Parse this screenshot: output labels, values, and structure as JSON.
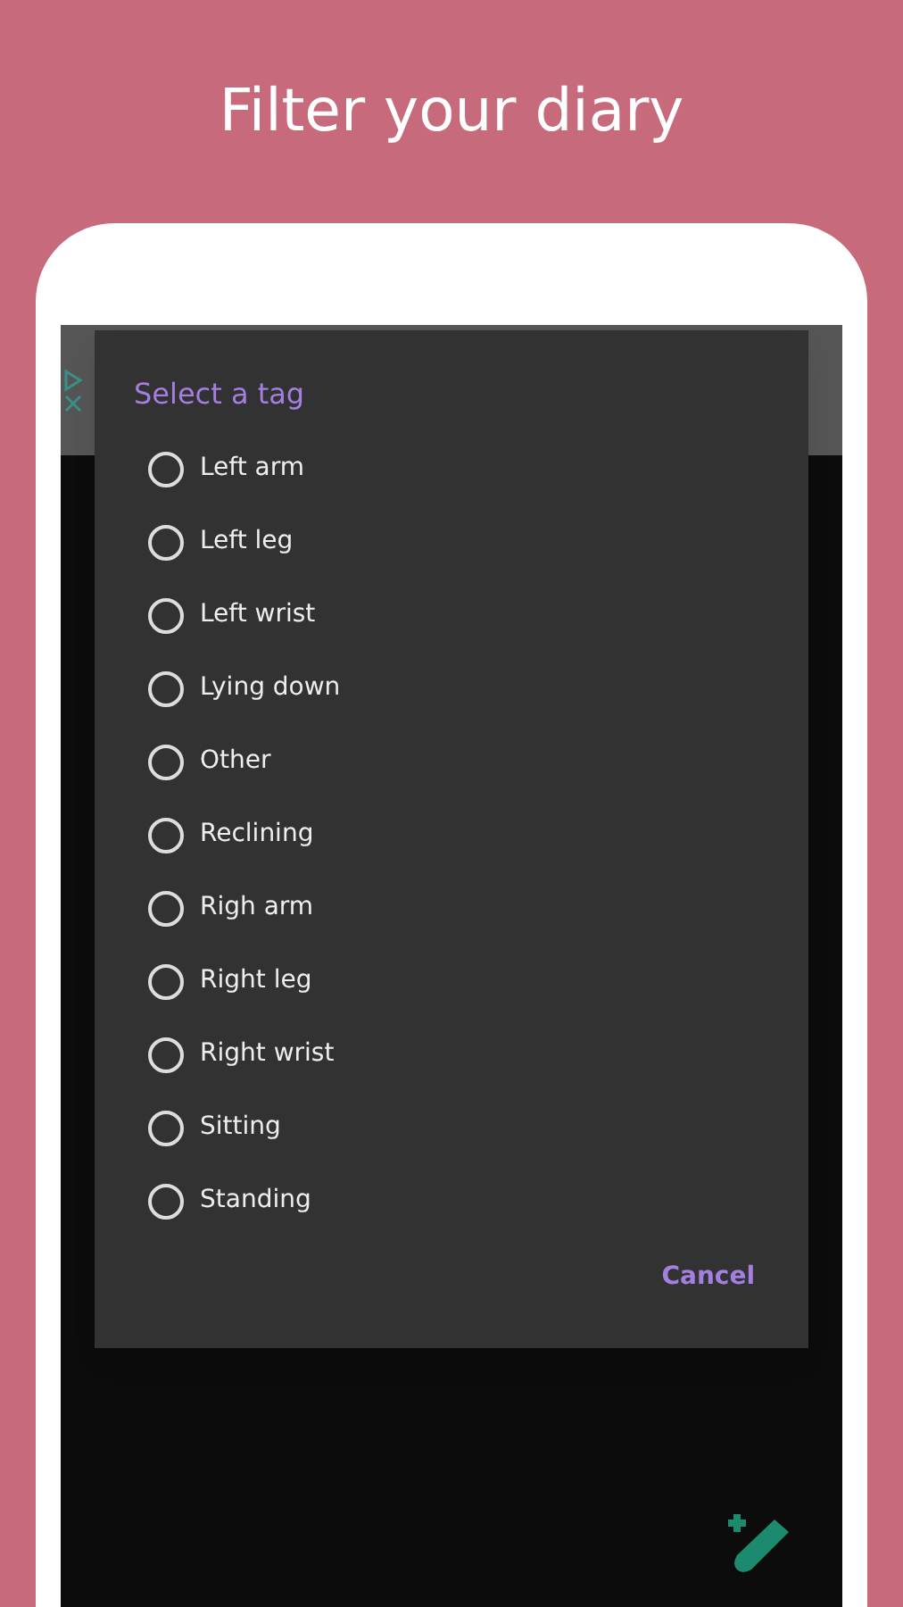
{
  "headline": "Filter your diary",
  "dialog": {
    "title": "Select a tag",
    "options": [
      {
        "label": "Left arm",
        "selected": false
      },
      {
        "label": "Left leg",
        "selected": false
      },
      {
        "label": "Left wrist",
        "selected": false
      },
      {
        "label": "Lying down",
        "selected": false
      },
      {
        "label": "Other",
        "selected": false
      },
      {
        "label": "Reclining",
        "selected": false
      },
      {
        "label": "Righ arm",
        "selected": false
      },
      {
        "label": "Right leg",
        "selected": false
      },
      {
        "label": "Right wrist",
        "selected": false
      },
      {
        "label": "Sitting",
        "selected": false
      },
      {
        "label": "Standing",
        "selected": false
      }
    ],
    "cancel": "Cancel"
  }
}
